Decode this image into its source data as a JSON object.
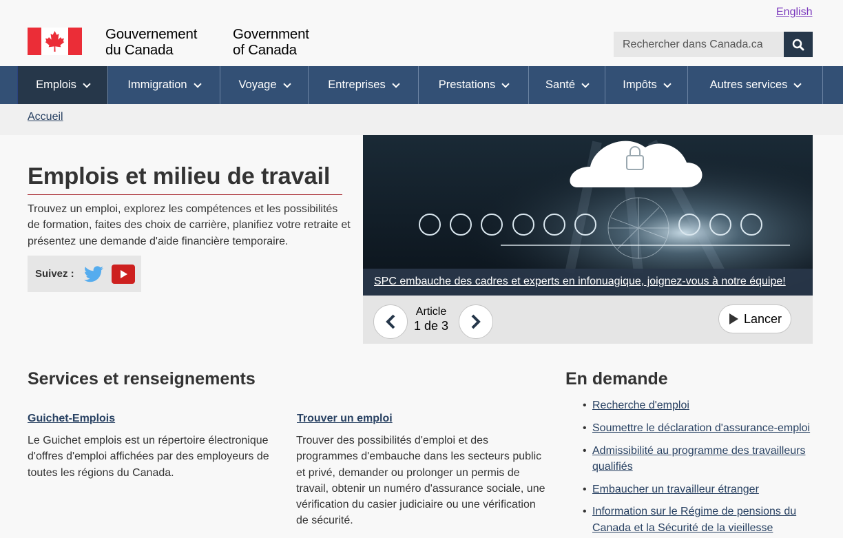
{
  "header": {
    "language_link": "English",
    "signature_fr_line1": "Gouvernement",
    "signature_fr_line2": "du Canada",
    "signature_en_line1": "Government",
    "signature_en_line2": "of Canada",
    "search_placeholder": "Rechercher dans Canada.ca",
    "colors": {
      "flag_red": "#eb2d37",
      "nav_bg": "#335075",
      "nav_active": "#26374a"
    }
  },
  "nav": {
    "items": [
      {
        "label": "Emplois"
      },
      {
        "label": "Immigration"
      },
      {
        "label": "Voyage"
      },
      {
        "label": "Entreprises"
      },
      {
        "label": "Prestations"
      },
      {
        "label": "Santé"
      },
      {
        "label": "Impôts"
      },
      {
        "label": "Autres services"
      }
    ]
  },
  "breadcrumb": {
    "home": "Accueil"
  },
  "intro": {
    "title": "Emplois et milieu de travail",
    "description": "Trouvez un emploi, explorez les compétences et les possibilités de formation, faites des choix de carrière, planifiez votre retraite et présentez une demande d'aide financière temporaire.",
    "follow_label": "Suivez :"
  },
  "carousel": {
    "caption": "SPC embauche des cadres et experts en infonuagique, joignez-vous à notre équipe!",
    "counter_label": "Article",
    "counter_value": "1 de 3",
    "play_label": "Lancer"
  },
  "services": {
    "heading": "Services et renseignements",
    "items": [
      {
        "title": "Guichet-Emplois",
        "description": "Le Guichet emplois est un répertoire électronique d'offres d'emploi affichées par des employeurs de toutes les régions du Canada."
      },
      {
        "title": "Trouver un emploi",
        "description": "Trouver des possibilités d'emploi et des programmes d'embauche dans les secteurs public et privé, demander ou prolonger un permis de travail, obtenir un numéro d'assurance sociale, une vérification du casier judiciaire ou une vérification de sécurité."
      }
    ]
  },
  "in_demand": {
    "heading": "En demande",
    "items": [
      "Recherche d'emploi",
      "Soumettre le déclaration d'assurance-emploi",
      "Admissibilité au programme des travailleurs qualifiés",
      "Embaucher un travailleur étranger",
      "Information sur le Régime de pensions du Canada et la Sécurité de la vieillesse"
    ]
  }
}
